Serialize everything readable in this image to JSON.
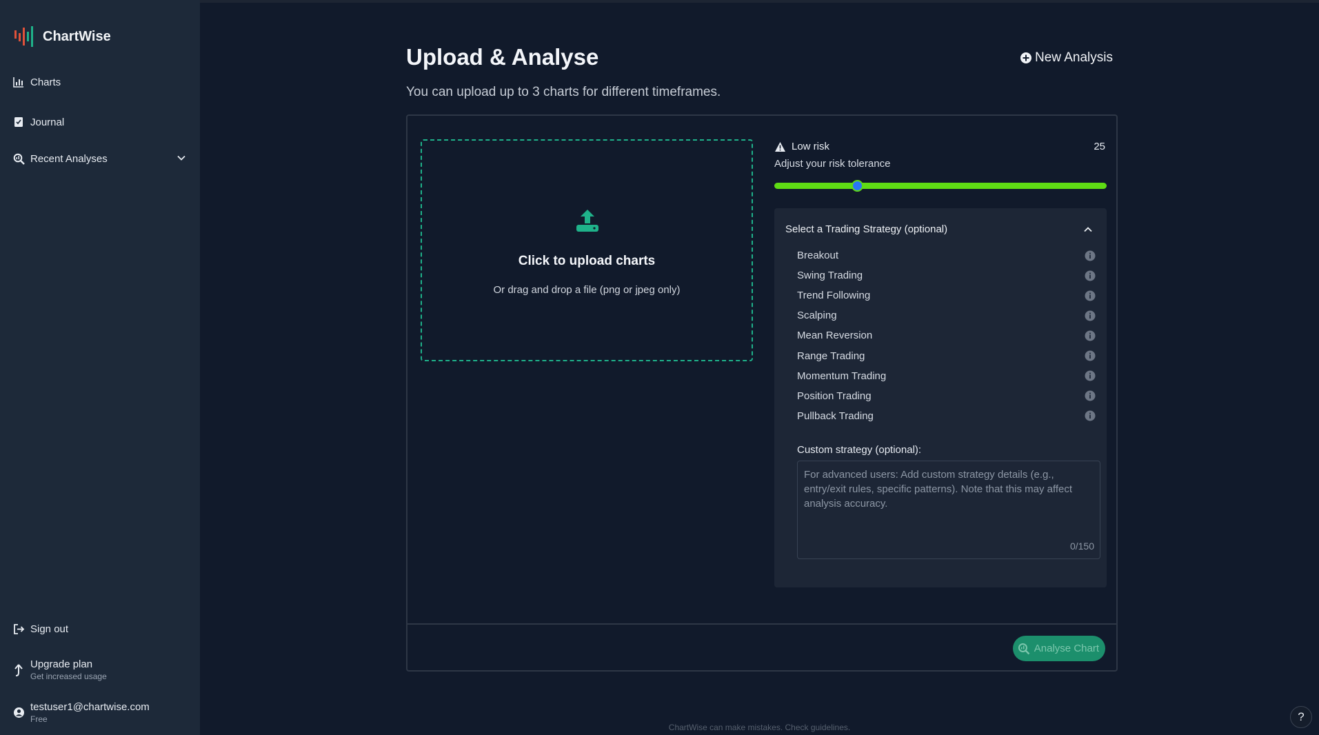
{
  "app": {
    "name": "ChartWise"
  },
  "sidebar": {
    "items": [
      {
        "label": "Charts",
        "icon": "bar-chart-icon"
      },
      {
        "label": "Journal",
        "icon": "journal-icon"
      },
      {
        "label": "Recent Analyses",
        "icon": "search-icon"
      }
    ],
    "sign_out": "Sign out",
    "upgrade": {
      "title": "Upgrade plan",
      "subtitle": "Get increased usage"
    },
    "user": {
      "email": "testuser1@chartwise.com",
      "plan": "Free"
    }
  },
  "header": {
    "title": "Upload & Analyse",
    "new_analysis": "New Analysis",
    "subtitle": "You can upload up to 3 charts for different timeframes."
  },
  "upload": {
    "title": "Click to upload charts",
    "subtitle": "Or drag and drop a file (png or jpeg only)"
  },
  "risk": {
    "label": "Low risk",
    "value": "25",
    "subtitle": "Adjust your risk tolerance",
    "slider_fraction": 0.25,
    "track_color": "#5fdc14",
    "thumb_color": "#2a76f6"
  },
  "strategy": {
    "header": "Select a Trading Strategy (optional)",
    "options": [
      "Breakout",
      "Swing Trading",
      "Trend Following",
      "Scalping",
      "Mean Reversion",
      "Range Trading",
      "Momentum Trading",
      "Position Trading",
      "Pullback Trading"
    ],
    "custom_label": "Custom strategy (optional):",
    "custom_placeholder": "For advanced users: Add custom strategy details (e.g., entry/exit rules, specific patterns). Note that this may affect analysis accuracy.",
    "char_count": "0/150"
  },
  "actions": {
    "analyse": "Analyse Chart"
  },
  "footer": {
    "note": "ChartWise can make mistakes. Check guidelines.",
    "help": "?"
  },
  "colors": {
    "accent": "#1fb28a",
    "sidebar_bg": "#1d2939",
    "page_bg": "#111a2b"
  }
}
